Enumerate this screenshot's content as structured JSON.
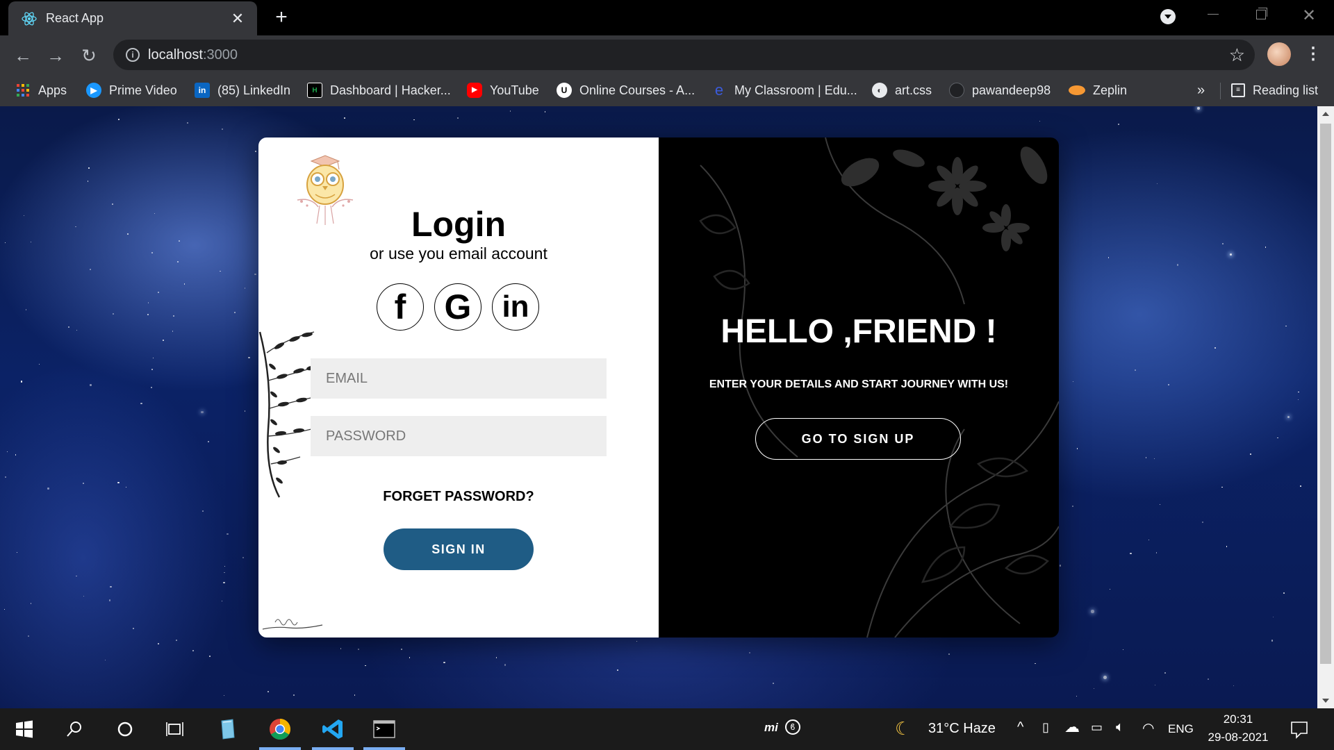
{
  "browser": {
    "tab_title": "React App",
    "url_host": "localhost",
    "url_port": ":3000",
    "new_tab_symbol": "+",
    "close_symbol": "✕"
  },
  "bookmarks": [
    {
      "label": "Apps",
      "icon": "apps-grid-icon",
      "color": "#4285f4"
    },
    {
      "label": "Prime Video",
      "icon": "prime-video-icon",
      "color": "#1a98ff"
    },
    {
      "label": "(85) LinkedIn",
      "icon": "linkedin-icon",
      "color": "#0a66c2"
    },
    {
      "label": "Dashboard | Hacker...",
      "icon": "hackerrank-icon",
      "color": "#1ba94c"
    },
    {
      "label": "YouTube",
      "icon": "youtube-icon",
      "color": "#ff0000"
    },
    {
      "label": "Online Courses - A...",
      "icon": "udemy-icon",
      "color": "#ffffff"
    },
    {
      "label": "My Classroom | Edu...",
      "icon": "edureka-icon",
      "color": "#1f3b99"
    },
    {
      "label": "art.css",
      "icon": "globe-icon",
      "color": "#e8eaed"
    },
    {
      "label": "pawandeep98",
      "icon": "github-icon",
      "color": "#202124"
    },
    {
      "label": "Zeplin",
      "icon": "zeplin-icon",
      "color": "#f69833"
    }
  ],
  "bookmarks_more": "»",
  "reading_list": "Reading list",
  "login": {
    "title": "Login",
    "subtitle": "or use you email account",
    "social": [
      "f",
      "G",
      "in"
    ],
    "email_placeholder": "EMAIL",
    "password_placeholder": "PASSWORD",
    "forget": "FORGET PASSWORD?",
    "signin": "SIGN IN"
  },
  "signup_panel": {
    "title": "HELLO ,FRIEND !",
    "subtitle": "ENTER YOUR DETAILS AND START JOURNEY WITH US!",
    "button": "GO TO SIGN UP"
  },
  "taskbar": {
    "weather": "31°C  Haze",
    "language": "ENG",
    "time": "20:31",
    "date": "29-08-2021",
    "mi_label": "mi"
  },
  "colors": {
    "signin_button": "#1f5c85",
    "tab_bg": "#35363a"
  }
}
